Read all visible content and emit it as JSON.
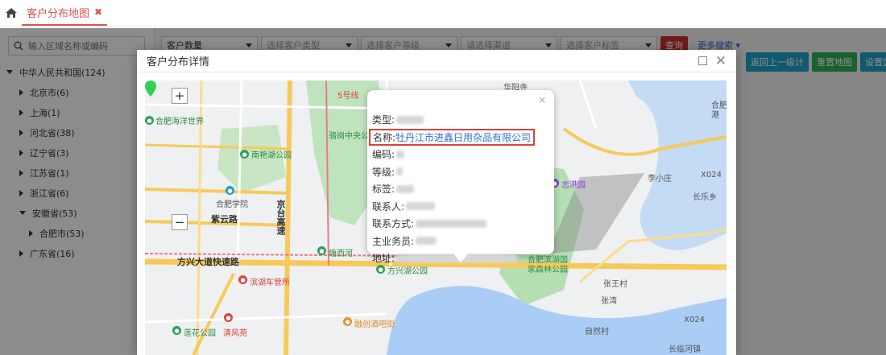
{
  "tabs": [
    {
      "label": "客户分布地图",
      "close": "✖"
    }
  ],
  "sidebar": {
    "search_placeholder": "输入区域名称或编码",
    "tree": [
      {
        "label": "中华人民共和国(124)",
        "expanded": true,
        "level": 0
      },
      {
        "label": "北京市(6)",
        "expanded": false,
        "level": 1
      },
      {
        "label": "上海(1)",
        "expanded": false,
        "level": 1
      },
      {
        "label": "河北省(38)",
        "expanded": false,
        "level": 1
      },
      {
        "label": "辽宁省(3)",
        "expanded": false,
        "level": 1
      },
      {
        "label": "江苏省(1)",
        "expanded": false,
        "level": 1
      },
      {
        "label": "浙江省(6)",
        "expanded": false,
        "level": 1
      },
      {
        "label": "安徽省(53)",
        "expanded": true,
        "level": 1
      },
      {
        "label": "合肥市(53)",
        "expanded": false,
        "level": 2
      },
      {
        "label": "广东省(16)",
        "expanded": false,
        "level": 1
      }
    ]
  },
  "filters": {
    "selects": [
      "客户数量",
      "选择客户类型",
      "选择客户等级",
      "请选择渠道",
      "选择客户标签"
    ],
    "query": "查询",
    "more": "更多搜索 ▾"
  },
  "actions": [
    "返回上一级计",
    "重置地图",
    "设置区间"
  ],
  "modal": {
    "title": "客户分布详情",
    "close": "✕",
    "zoom_in": "+",
    "zoom_out": "−",
    "popup": {
      "close": "×",
      "fields": [
        {
          "label": "类型:",
          "value": "",
          "blur": 34
        },
        {
          "label": "名称:",
          "value": "牡丹江市进鑫日用杂品有限公司",
          "highlight": true
        },
        {
          "label": "编码:",
          "value": "",
          "blur": 10
        },
        {
          "label": "等级:",
          "value": "",
          "blur": 8
        },
        {
          "label": "标签:",
          "value": "",
          "blur": 22
        },
        {
          "label": "联系人:",
          "value": "",
          "blur": 36
        },
        {
          "label": "联系方式:",
          "value": "",
          "blur": 88
        },
        {
          "label": "主业务员:",
          "value": "",
          "blur": 26
        },
        {
          "label": "地址:",
          "value": "",
          "blur": 150
        }
      ]
    },
    "map_labels": {
      "ocean_world": "合肥海洋世界",
      "nanyan_park": "南艳湖公园",
      "hefei_college": "合肥学院",
      "ziyun_road": "紫云路",
      "jingtai_highway": "京台高速",
      "fangxing_road": "方兴大道快速路",
      "tangxi": "塘西河",
      "fangxing_lake": "方兴湖公园",
      "binhu_station": "滨湖车管所",
      "lianhua_park": "莲花公园",
      "qingfeng": "清风苑",
      "rongchuang": "融创酒吧街",
      "luogang": "骆岗中央公园",
      "line5": "5号线",
      "zhigang_park": "志港园",
      "forest_park": "合肥滨湖国家森林公园",
      "hefei_port": "合肥港",
      "xiaozhuang": "李小庄",
      "lekang": "长乐乡",
      "zhangwang": "张王村",
      "zhangwan": "张湾",
      "ziran": "自然村",
      "x024a": "X024",
      "x024b": "X024",
      "changlin": "长临河镇",
      "huayang": "华阳寺",
      "xiaojun": "合肥"
    },
    "accent_red": "#d9423b",
    "link_blue": "#2f6fd1"
  }
}
